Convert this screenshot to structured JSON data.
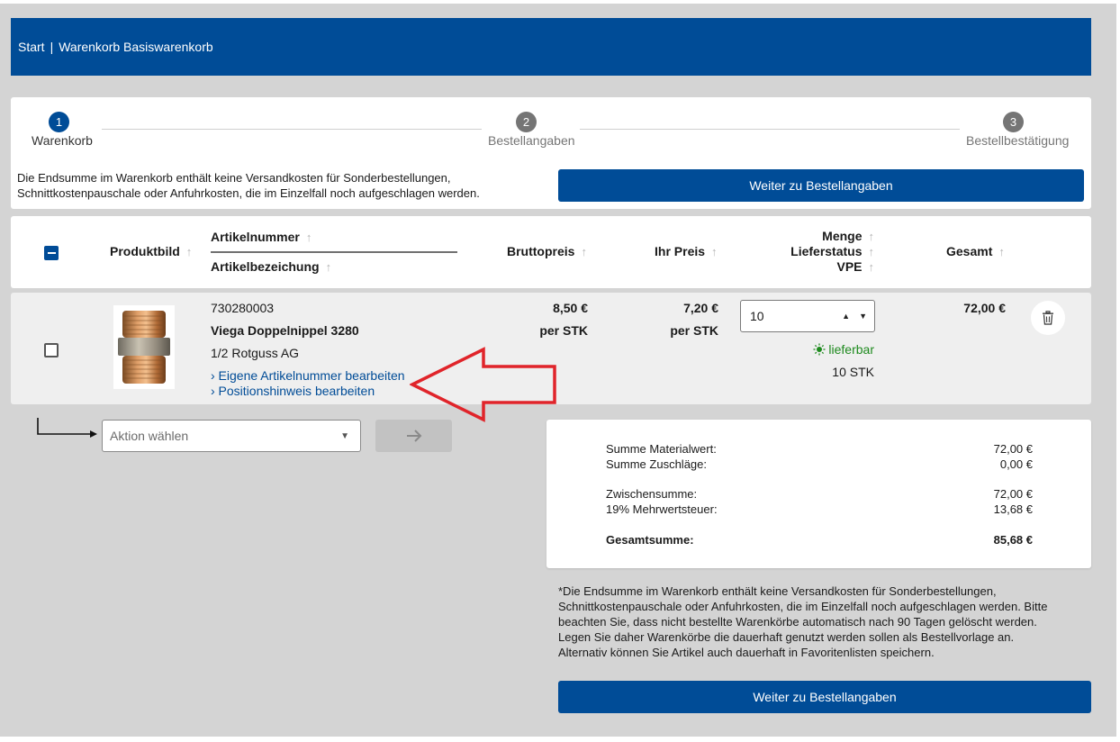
{
  "breadcrumb": {
    "home": "Start",
    "separator": "|",
    "current": "Warenkorb Basiswarenkorb"
  },
  "stepper": {
    "steps": [
      {
        "number": "1",
        "label": "Warenkorb",
        "active": true
      },
      {
        "number": "2",
        "label": "Bestellangaben",
        "active": false
      },
      {
        "number": "3",
        "label": "Bestellbestätigung",
        "active": false
      }
    ],
    "info_line1": "Die Endsumme im Warenkorb enthält keine Versandkosten für Sonderbestellungen,",
    "info_line2": "Schnittkostenpauschale oder Anfuhrkosten, die im Einzelfall noch aufgeschlagen werden.",
    "continue_button": "Weiter zu Bestellangaben"
  },
  "table": {
    "headers": {
      "produktbild": "Produktbild",
      "artikelnummer": "Artikelnummer",
      "artikelbezeichnung": "Artikelbezeichung",
      "bruttopreis": "Bruttopreis",
      "ihr_preis": "Ihr Preis",
      "menge": "Menge",
      "lieferstatus": "Lieferstatus",
      "vpe": "VPE",
      "gesamt": "Gesamt"
    },
    "sort_icon": "arrow-up-icon"
  },
  "item": {
    "article_number": "730280003",
    "name": "Viega Doppelnippel 3280",
    "description": "1/2 Rotguss AG",
    "link_article_number": "› Eigene Artikelnummer bearbeiten",
    "link_position_note": "› Positionshinweis bearbeiten",
    "gross_price": "8,50 €",
    "gross_unit": "per STK",
    "your_price": "7,20 €",
    "your_unit": "per STK",
    "quantity": "10",
    "availability": "lieferbar",
    "vpe": "10 STK",
    "total": "72,00 €"
  },
  "actions": {
    "select_placeholder": "Aktion wählen"
  },
  "summary": {
    "material_label": "Summe Materialwert:",
    "material_value": "72,00 €",
    "surcharge_label": "Summe Zuschläge:",
    "surcharge_value": "0,00 €",
    "subtotal_label": "Zwischensumme:",
    "subtotal_value": "72,00 €",
    "vat_label": "19% Mehrwertsteuer:",
    "vat_value": "13,68 €",
    "total_label": "Gesamtsumme:",
    "total_value": "85,68 €"
  },
  "footnote": {
    "line1": "*Die Endsumme im Warenkorb enthält keine Versandkosten für Sonderbestellungen,",
    "line2": "Schnittkostenpauschale oder Anfuhrkosten, die im Einzelfall noch aufgeschlagen werden. Bitte",
    "line3": "beachten Sie, dass nicht bestellte Warenkörbe automatisch nach 90 Tagen gelöscht werden.",
    "line4": "Legen Sie daher Warenkörbe die dauerhaft genutzt werden sollen als Bestellvorlage an.",
    "line5": "Alternativ können Sie Artikel auch dauerhaft in Favoritenlisten speichern."
  },
  "bottom_button": "Weiter zu Bestellangaben",
  "colors": {
    "primary": "#004c97",
    "available": "#1e8a1e",
    "annotation": "#e0242a"
  }
}
